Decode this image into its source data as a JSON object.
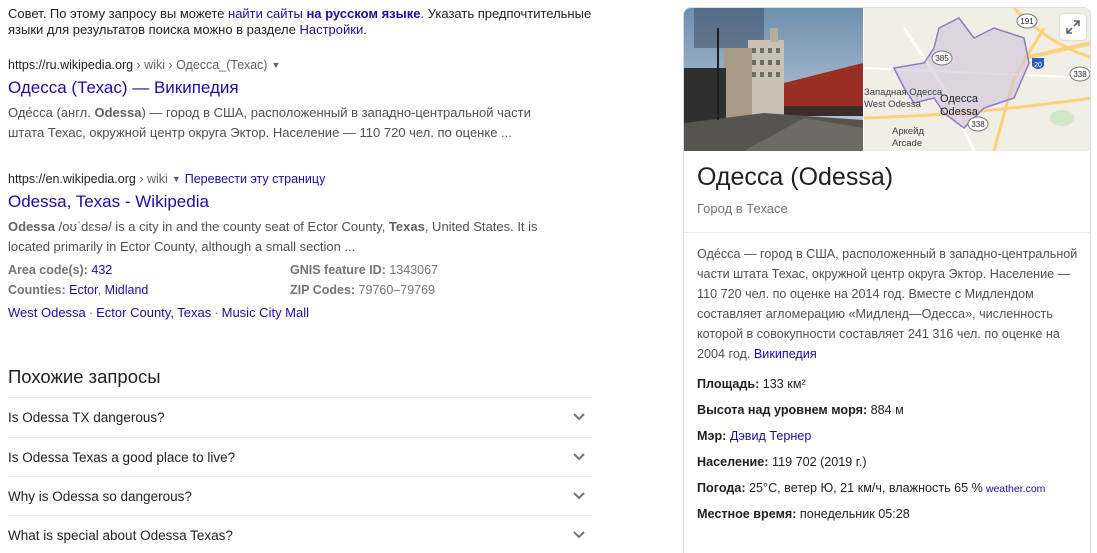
{
  "tip": {
    "prefix": "Совет. По этому запросу вы можете ",
    "link1": "найти сайты",
    "link2": "на русском языке",
    "middle": ". Указать предпочтительные языки для результатов поиска можно в разделе ",
    "link3": "Настройки",
    "suffix": "."
  },
  "results": [
    {
      "cite_domain": "https://ru.wikipedia.org",
      "cite_path": " › wiki › Одесса_(Техас)",
      "caret": "▼",
      "title": "Одесса (Техас) — Википедия",
      "snippet_pre": "Оде́сса (англ. ",
      "snippet_bold": "Odessa",
      "snippet_post": ") — город в США, расположенный в западно-центральной части штата Техас, окружной центр округа Эктор. Население — 110 720 чел. по оценке ..."
    },
    {
      "cite_domain": "https://en.wikipedia.org",
      "cite_path": " › wiki",
      "caret": "▼",
      "translate": "Перевести эту страницу",
      "title": "Odessa, Texas - Wikipedia",
      "snippet_bold1": "Odessa",
      "snippet_mid": " /oʊˈdɛsə/ is a city in and the county seat of Ector County, ",
      "snippet_bold2": "Texas",
      "snippet_post": ", United States. It is located primarily in Ector County, although a small section ..."
    }
  ],
  "facts": {
    "area_label": "Area code(s):",
    "area_value": "432",
    "gnis_label": "GNIS feature ID:",
    "gnis_value": "1343067",
    "counties_label": "Counties:",
    "county1": "Ector",
    "county_sep": ", ",
    "county2": "Midland",
    "zip_label": "ZIP Codes:",
    "zip_value": "79760–79769"
  },
  "sitelinks": [
    "West Odessa",
    "Ector County, Texas",
    "Music City Mall"
  ],
  "sitelink_sep": "·",
  "related": {
    "title": "Похожие запросы",
    "items": [
      "Is Odessa TX dangerous?",
      "Is Odessa Texas a good place to live?",
      "Why is Odessa so dangerous?",
      "What is special about Odessa Texas?"
    ]
  },
  "panel": {
    "title": "Одесса (Odessa)",
    "subtitle": "Город в Техасе",
    "map_labels": {
      "west_odessa_1": "Западная Одесса",
      "west_odessa_2": "West Odessa",
      "odessa_ru": "Одесса",
      "odessa_en": "Odessa",
      "arcade_ru": "Аркейд",
      "arcade_en": "Arcade",
      "hwy_191": "191",
      "hwy_385": "385",
      "hwy_20": "20",
      "hwy_338a": "338",
      "hwy_338b": "338"
    },
    "description": "Оде́сса — город в США, расположенный в западно-центральной части штата Техас, окружной центр округа Эктор. Население — 110 720 чел. по оценке на 2014 год. Вместе с Мидлендом составляет агломерацию «Мидленд—Одесса», численность которой в совокупности составляет 241 316 чел. по оценке на 2004 год. ",
    "description_source": "Википедия",
    "facts": [
      {
        "key": "Площадь:",
        "value": " 133 км²"
      },
      {
        "key": "Высота над уровнем моря:",
        "value": " 884 м"
      },
      {
        "key": "Мэр:",
        "value_link": " Дэвид Тернер"
      },
      {
        "key": "Население:",
        "value": " 119 702 (2019 г.)"
      },
      {
        "key": "Погода:",
        "value": " 25°C, ветер Ю, 21 км/ч, влажность 65 %",
        "source": "weather.com"
      },
      {
        "key": "Местное время:",
        "value": " понедельник 05:28"
      }
    ]
  }
}
